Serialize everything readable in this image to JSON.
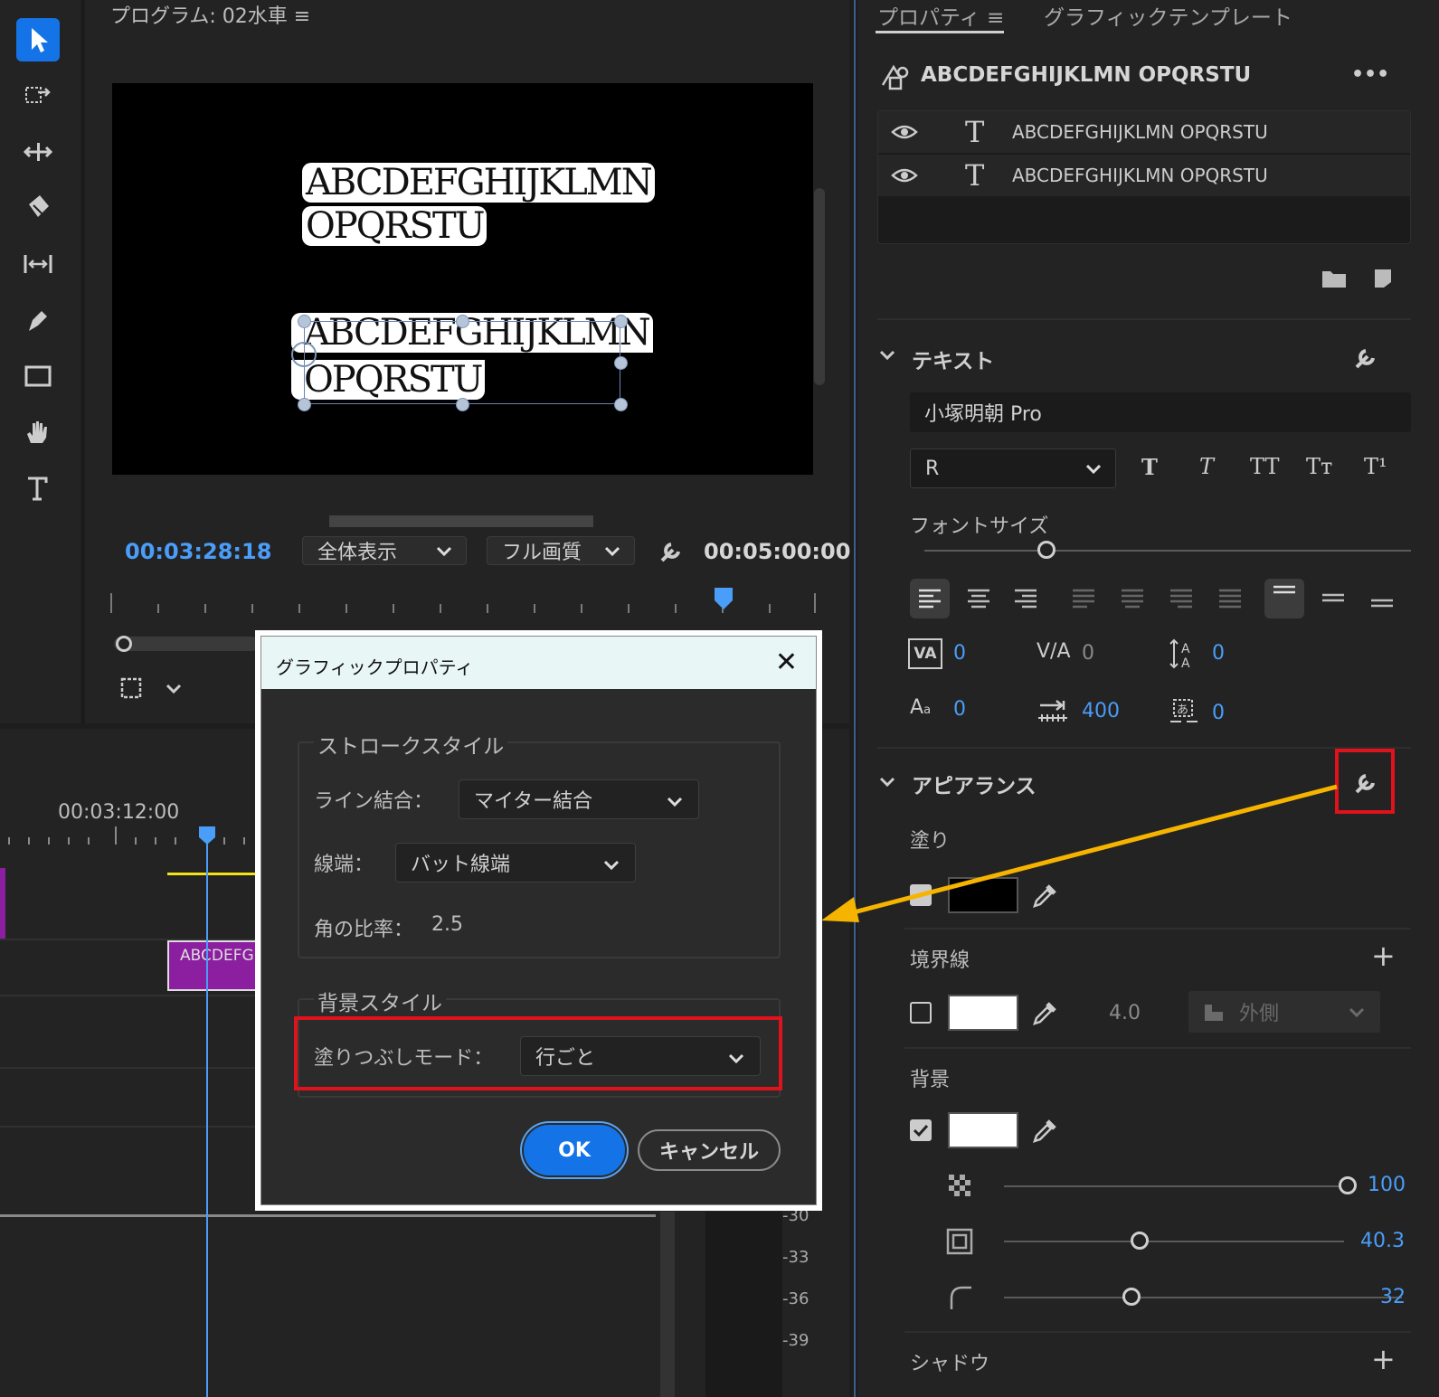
{
  "toolbar": {
    "tools": [
      {
        "name": "selection-tool",
        "icon": "arrow-icon",
        "active": true
      },
      {
        "name": "track-select-tool",
        "icon": "track-select-icon"
      },
      {
        "name": "ripple-edit-tool",
        "icon": "ripple-icon"
      },
      {
        "name": "razor-tool",
        "icon": "razor-icon"
      },
      {
        "name": "slip-tool",
        "icon": "slip-icon"
      },
      {
        "name": "pen-tool",
        "icon": "pen-icon"
      },
      {
        "name": "rectangle-tool",
        "icon": "rectangle-icon"
      },
      {
        "name": "hand-tool",
        "icon": "hand-icon"
      },
      {
        "name": "type-tool",
        "icon": "type-icon"
      }
    ]
  },
  "program": {
    "title": "プログラム: 02水車",
    "text_line1": "ABCDEFGHIJKLMN",
    "text_line2": "OPQRSTU",
    "current_time": "00:03:28:18",
    "zoom_select": "全体表示",
    "quality_select": "フル画質",
    "duration": "00:05:00:00"
  },
  "timeline": {
    "timecode": "00:03:12:00",
    "clip_label": "ABCDEFGHIJKLMN",
    "db_labels": [
      "-30",
      "-33",
      "-36",
      "-39"
    ]
  },
  "properties": {
    "tab_properties": "プロパティ",
    "tab_graphic_template": "グラフィックテンプレート",
    "object_title": "ABCDEFGHIJKLMN OPQRSTU",
    "more": "•••",
    "layers": [
      {
        "name": "ABCDEFGHIJKLMN OPQRSTU"
      },
      {
        "name": "ABCDEFGHIJKLMN OPQRSTU"
      }
    ],
    "text_section": "テキスト",
    "font_family": "小塚明朝 Pro",
    "font_style": "R",
    "style_buttons": [
      "T",
      "T",
      "TT",
      "Tт",
      "T¹"
    ],
    "font_size_label": "フォントサイズ",
    "font_size_value": 0.25,
    "kerning": "0",
    "tracking": "0",
    "leading": "0",
    "baseline": "0",
    "tab_width": "400",
    "tsume": "0",
    "appearance_section": "アピアランス",
    "fill_label": "塗り",
    "fill_color": "#000000",
    "stroke_label": "境界線",
    "stroke_color": "#ffffff",
    "stroke_width": "4.0",
    "stroke_position": "外側",
    "background_label": "背景",
    "background_color": "#ffffff",
    "bg_opacity": "100",
    "bg_opacity_value": 1.0,
    "bg_size": "40.3",
    "bg_size_value": 0.4,
    "bg_corner": "32",
    "bg_corner_value": 0.32,
    "shadow_label": "シャドウ"
  },
  "dialog": {
    "title": "グラフィックプロパティ",
    "close": "✕",
    "stroke_style_legend": "ストロークスタイル",
    "line_join_label": "ライン結合：",
    "line_join_value": "マイター結合",
    "line_cap_label": "線端：",
    "line_cap_value": "バット線端",
    "miter_label": "角の比率：",
    "miter_value": "2.5",
    "bg_style_legend": "背景スタイル",
    "fill_mode_label": "塗りつぶしモード：",
    "fill_mode_value": "行ごと",
    "ok": "OK",
    "cancel": "キャンセル"
  },
  "colors": {
    "accent": "#1473e6",
    "highlight": "#e0121b",
    "arrow": "#f6b400",
    "timecode_blue": "#4a9df8"
  }
}
